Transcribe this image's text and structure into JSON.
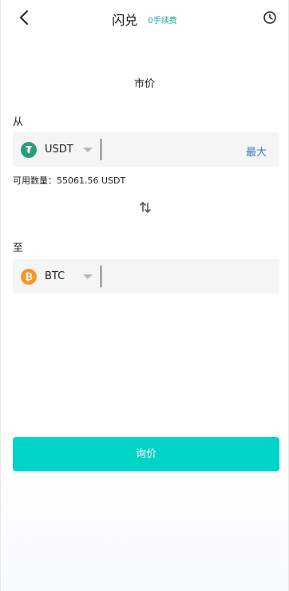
{
  "header": {
    "title": "闪兑",
    "fee_badge": "0手续费",
    "back_icon": "chevron-left-icon",
    "history_icon": "clock-icon"
  },
  "mode": {
    "label": "市价"
  },
  "from": {
    "label": "从",
    "coin_symbol": "USDT",
    "coin_icon_glyph": "₮",
    "amount_value": "",
    "max_label": "最大",
    "available_text": "可用数量：55061.56 USDT"
  },
  "to": {
    "label": "至",
    "coin_symbol": "BTC",
    "coin_icon_glyph": "₿",
    "amount_value": ""
  },
  "actions": {
    "quote_label": "询价"
  },
  "colors": {
    "accent": "#00d4c6",
    "fee_badge": "#1aa9a0",
    "max_link": "#3b78c4",
    "usdt_icon": "#2a9d7c",
    "btc_icon": "#f19a2b"
  }
}
